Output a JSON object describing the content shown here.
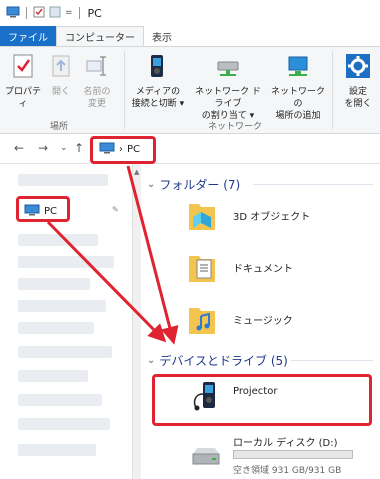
{
  "window": {
    "title": "PC"
  },
  "tabs": [
    "ファイル",
    "コンピューター",
    "表示"
  ],
  "ribbon": {
    "location_group": {
      "label": "場所",
      "buttons": [
        {
          "label": "プロパティ",
          "enabled": true
        },
        {
          "label": "開く",
          "enabled": false
        },
        {
          "label": "名前の\n変更",
          "enabled": false
        }
      ]
    },
    "network_group": {
      "label": "ネットワーク",
      "buttons": [
        {
          "label": "メディアの\n接続と切断 ▾"
        },
        {
          "label": "ネットワーク ドライブ\nの割り当て ▾"
        },
        {
          "label": "ネットワークの\n場所の追加"
        }
      ]
    },
    "system_button": {
      "label": "設定\nを開く"
    }
  },
  "address": {
    "crumb_separator": "›",
    "location": "PC"
  },
  "navpane": {
    "pc_label": "PC"
  },
  "content": {
    "folders_header": "フォルダー (7)",
    "folders": [
      "3D オブジェクト",
      "ドキュメント",
      "ミュージック"
    ],
    "devices_header": "デバイスとドライブ (5)",
    "devices": [
      {
        "name": "Projector"
      },
      {
        "name": "ローカル ディスク (D:)",
        "free_text": "空き領域 931 GB/931 GB",
        "used_fraction": 0.0
      }
    ]
  },
  "colors": {
    "accent": "#1a6fc9",
    "highlight": "#e02330",
    "section_text": "#1e3a8a"
  }
}
